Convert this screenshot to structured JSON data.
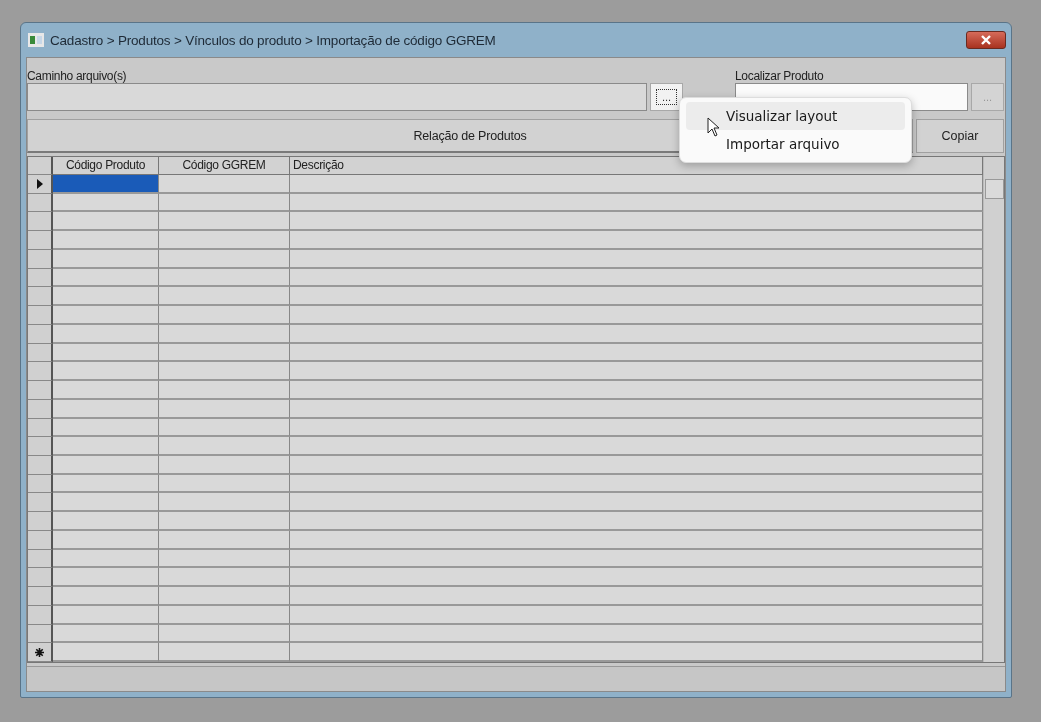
{
  "window": {
    "title": "Cadastro > Produtos > Vínculos do produto > Importação de código GGREM"
  },
  "file_path": {
    "label": "Caminho arquivo(s)",
    "browse_button": "..."
  },
  "find_product": {
    "label": "Localizar Produto",
    "browse_button": "..."
  },
  "product_list": {
    "title": "Relação de Produtos",
    "copy_button": "Copiar"
  },
  "grid": {
    "columns": [
      "Código Produto",
      "Código GGREM",
      "Descrição"
    ],
    "rows": [
      {
        "kind": "record",
        "selected": true
      },
      {
        "kind": "record",
        "selected": false
      },
      {
        "kind": "record",
        "selected": false
      },
      {
        "kind": "record",
        "selected": false
      },
      {
        "kind": "record",
        "selected": false
      },
      {
        "kind": "record",
        "selected": false
      },
      {
        "kind": "record",
        "selected": false
      },
      {
        "kind": "record",
        "selected": false
      },
      {
        "kind": "record",
        "selected": false
      },
      {
        "kind": "record",
        "selected": false
      },
      {
        "kind": "record",
        "selected": false
      },
      {
        "kind": "record",
        "selected": false
      },
      {
        "kind": "record",
        "selected": false
      },
      {
        "kind": "record",
        "selected": false
      },
      {
        "kind": "record",
        "selected": false
      },
      {
        "kind": "record",
        "selected": false
      },
      {
        "kind": "record",
        "selected": false
      },
      {
        "kind": "record",
        "selected": false
      },
      {
        "kind": "record",
        "selected": false
      },
      {
        "kind": "record",
        "selected": false
      },
      {
        "kind": "record",
        "selected": false
      },
      {
        "kind": "record",
        "selected": false
      },
      {
        "kind": "record",
        "selected": false
      },
      {
        "kind": "record",
        "selected": false
      },
      {
        "kind": "record",
        "selected": false
      },
      {
        "kind": "new",
        "selected": false
      }
    ]
  },
  "context_menu": {
    "items": [
      {
        "label": "Visualizar layout",
        "selected": true
      },
      {
        "label": "Importar arquivo",
        "selected": false
      }
    ]
  }
}
